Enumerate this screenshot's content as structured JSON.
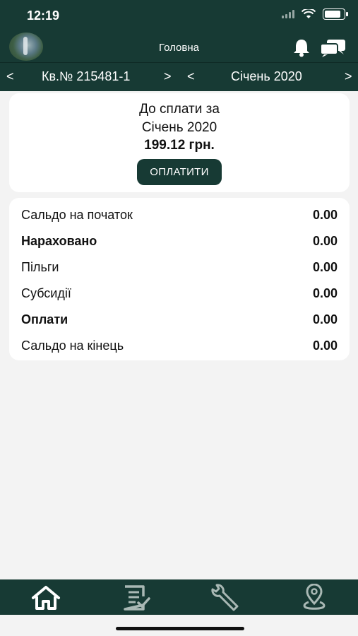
{
  "status_bar": {
    "time": "12:19"
  },
  "header": {
    "title": "Головна",
    "icons": [
      "avatar",
      "bell-icon",
      "chat-icon"
    ]
  },
  "selector": {
    "prev_account": "<",
    "account": "Кв.№ 215481-1",
    "next_account": ">",
    "prev_period": "<",
    "period": "Січень 2020",
    "next_period": ">"
  },
  "payment": {
    "line1": "До сплати за",
    "line2": "Січень 2020",
    "amount": "199.12 грн.",
    "button": "ОПЛАТИТИ"
  },
  "balance": {
    "rows": [
      {
        "label": "Сальдо на початок",
        "value": "0.00",
        "bold": false
      },
      {
        "label": "Нараховано",
        "value": "0.00",
        "bold": true
      },
      {
        "label": "Пільги",
        "value": "0.00",
        "bold": false
      },
      {
        "label": "Субсидії",
        "value": "0.00",
        "bold": false
      },
      {
        "label": "Оплати",
        "value": "0.00",
        "bold": true
      },
      {
        "label": "Сальдо на кінець",
        "value": "0.00",
        "bold": false
      }
    ]
  },
  "bottom_nav": {
    "items": [
      "home-icon",
      "invoice-icon",
      "wrench-icon",
      "location-pin-icon"
    ]
  },
  "colors": {
    "primary": "#173a34",
    "background": "#f3f3f3",
    "card": "#ffffff"
  }
}
